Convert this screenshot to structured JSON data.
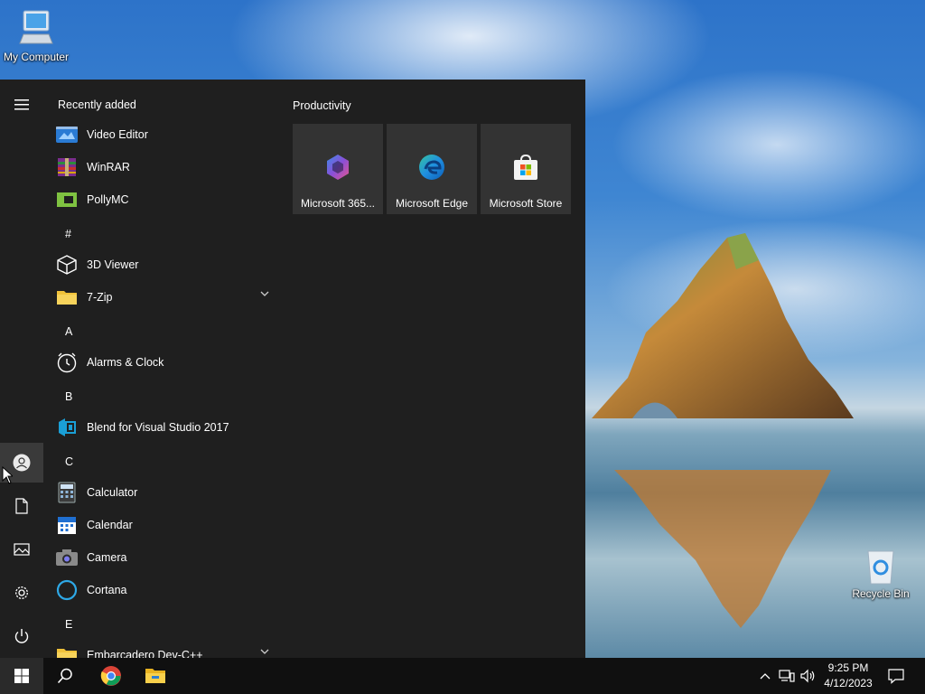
{
  "desktop": {
    "icons": [
      {
        "label": "My Computer",
        "icon": "computer-icon"
      },
      {
        "label": "Recycle Bin",
        "icon": "recycle-bin-icon"
      }
    ]
  },
  "start_menu": {
    "recently_added_title": "Recently added",
    "recent_apps": [
      {
        "label": "Video Editor",
        "icon": "video-editor-icon"
      },
      {
        "label": "WinRAR",
        "icon": "winrar-icon"
      },
      {
        "label": "PollyMC",
        "icon": "pollymc-icon"
      }
    ],
    "groups": [
      {
        "letter": "#",
        "apps": [
          {
            "label": "3D Viewer",
            "icon": "cube-icon"
          },
          {
            "label": "7-Zip",
            "icon": "folder-icon",
            "expandable": true
          }
        ]
      },
      {
        "letter": "A",
        "apps": [
          {
            "label": "Alarms & Clock",
            "icon": "clock-icon"
          }
        ]
      },
      {
        "letter": "B",
        "apps": [
          {
            "label": "Blend for Visual Studio 2017",
            "icon": "blend-icon"
          }
        ]
      },
      {
        "letter": "C",
        "apps": [
          {
            "label": "Calculator",
            "icon": "calculator-icon"
          },
          {
            "label": "Calendar",
            "icon": "calendar-icon"
          },
          {
            "label": "Camera",
            "icon": "camera-icon"
          },
          {
            "label": "Cortana",
            "icon": "cortana-icon"
          }
        ]
      },
      {
        "letter": "E",
        "apps": [
          {
            "label": "Embarcadero Dev-C++",
            "icon": "folder-icon",
            "expandable": true
          }
        ]
      }
    ],
    "rail": [
      "hamburger-menu-icon",
      "user-account-icon",
      "documents-icon",
      "pictures-icon",
      "settings-gear-icon",
      "power-icon"
    ],
    "tiles_group_title": "Productivity",
    "tiles": [
      {
        "label": "Microsoft 365...",
        "icon": "microsoft-365-icon"
      },
      {
        "label": "Microsoft Edge",
        "icon": "edge-icon"
      },
      {
        "label": "Microsoft Store",
        "icon": "store-icon"
      }
    ]
  },
  "taskbar": {
    "pinned": [
      "windows-start-icon",
      "search-icon",
      "chrome-icon",
      "file-explorer-icon"
    ],
    "tray": [
      "show-hidden-icons-chevron",
      "network-icon",
      "volume-icon",
      "action-center-icon"
    ],
    "time": "9:25 PM",
    "date": "4/12/2023"
  },
  "colors": {
    "start_bg": "#1f1f1f",
    "tile_bg": "#333333",
    "taskbar_bg": "#101010",
    "accent": "#0078d7"
  }
}
